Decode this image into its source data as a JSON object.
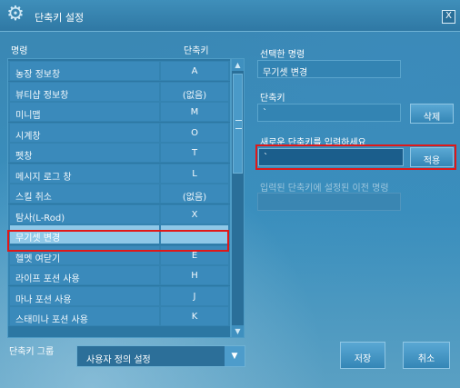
{
  "window": {
    "title": "단축키 설정",
    "close_label": "X"
  },
  "list": {
    "header_name": "명령",
    "header_key": "단축키",
    "rows": [
      {
        "name": "농장 정보창",
        "key": "A"
      },
      {
        "name": "뷰티샵 정보창",
        "key": "(없음)"
      },
      {
        "name": "미니맵",
        "key": "M"
      },
      {
        "name": "시계창",
        "key": "O"
      },
      {
        "name": "펫창",
        "key": "T"
      },
      {
        "name": "메시지 로그 창",
        "key": "L"
      },
      {
        "name": "스킬 취소",
        "key": "(없음)"
      },
      {
        "name": "탐사(L-Rod)",
        "key": "X"
      },
      {
        "name": "무기셋 변경",
        "key": "`"
      },
      {
        "name": "헬멧 여닫기",
        "key": "E"
      },
      {
        "name": "라이프 포션 사용",
        "key": "H"
      },
      {
        "name": "마나 포션 사용",
        "key": "J"
      },
      {
        "name": "스태미나 포션 사용",
        "key": "K"
      }
    ],
    "selected_index": 8
  },
  "selected_command": {
    "label": "선택한 명령",
    "value": "무기셋 변경"
  },
  "current_key": {
    "label": "단축키",
    "value": "`",
    "delete_label": "삭제"
  },
  "new_key": {
    "label": "새로운 단축키를 입력하세요",
    "value": "`",
    "apply_label": "적용"
  },
  "previous_binding": {
    "label": "입력된 단축키에 설정된 이전 명령",
    "value": ""
  },
  "group": {
    "label": "단축키 그룹",
    "value": "사용자 정의 설정"
  },
  "footer": {
    "save_label": "저장",
    "cancel_label": "취소"
  }
}
